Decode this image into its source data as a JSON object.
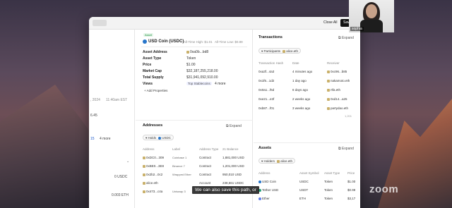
{
  "topbar": {
    "close_all": "Close All",
    "save": "Save"
  },
  "webcam": {
    "name": "sophia"
  },
  "left_pane": {
    "date_fragment": ", 2024",
    "time_fragment": "11:40am EST",
    "number_fragment": "6.45",
    "link_fragment": "15",
    "more": "4 more",
    "usdc_fragment": "0 USDC",
    "eth_fragment": "0.003 ETH"
  },
  "entity": {
    "badge": "Asset",
    "name": "USD Coin (USDC)",
    "ath": "All-Time High: $1.01",
    "atl": "All-Time Low: $0.89",
    "fields": [
      {
        "label": "Asset Address",
        "value": "0xa0b...bd8"
      },
      {
        "label": "Asset Type",
        "value": "Token"
      },
      {
        "label": "Price",
        "value": "$1.00"
      },
      {
        "label": "Market Cap",
        "value": "$32,187,255,218.00"
      },
      {
        "label": "Total Supply",
        "value": "$31,941,092,910.00"
      },
      {
        "label": "Views",
        "value": "Top Stablecoins"
      }
    ],
    "views_more": "4 more",
    "add_properties": "+ Add Properties"
  },
  "addresses": {
    "title": "Addresses",
    "expand": "Expand",
    "filter_key": "Holds",
    "filter_value": "USDC",
    "columns": [
      "Address",
      "Label",
      "Address Type",
      "21 Balance"
    ],
    "rows": [
      {
        "address": "0xDC0...309",
        "label": "Coinbase 1",
        "type": "Contract",
        "balance": "1,881,000 USD"
      },
      {
        "address": "0xBE0...3E8",
        "label": "Binance 7",
        "type": "Contract",
        "balance": "1,201,000 USD"
      },
      {
        "address": "0x2b2...0c2",
        "label": "Wrapped Ether",
        "type": "Contract",
        "balance": "950,010 USD"
      },
      {
        "address": "alice.eth",
        "label": "",
        "type": "Account",
        "balance": "238,661 USDC"
      },
      {
        "address": "0x473...c4a",
        "label": "Uniswap 3",
        "type": "Account",
        "balance": "450,673 USDC"
      }
    ]
  },
  "transactions": {
    "title": "Transactions",
    "expand": "Expand",
    "filter_key": "Participants",
    "filter_value": "alice.eth",
    "columns": [
      "Transaction Hash",
      "Date",
      "Receiver"
    ],
    "rows": [
      {
        "hash": "0xa3f...4a3",
        "date": "4 minutes ago",
        "receiver": "0xc96...b85"
      },
      {
        "hash": "0x1f6...1d2",
        "date": "1 day ago",
        "receiver": "nakamoto.eth"
      },
      {
        "hash": "0x0a1...f6d",
        "date": "6 days ago",
        "receiver": "rtfa.eth"
      },
      {
        "hash": "0xe21...e3f",
        "date": "2 weeks ago",
        "receiver": "0xd14...a25"
      },
      {
        "hash": "0xb87...f01",
        "date": "3 weeks ago",
        "receiver": "partydao.eth"
      }
    ],
    "count": "1,201"
  },
  "assets": {
    "title": "Assets",
    "expand": "Expand",
    "filter_key": "Holders",
    "filter_value": "alice.eth",
    "columns": [
      "Address",
      "Asset Symbol",
      "Asset Type",
      "Price"
    ],
    "rows": [
      {
        "name": "USD Coin",
        "symbol": "USDC",
        "type": "Token",
        "price": "$1.00"
      },
      {
        "name": "Tether USD",
        "symbol": "USDT",
        "type": "Token",
        "price": "$0.99"
      },
      {
        "name": "Ether",
        "symbol": "ETH",
        "type": "Token",
        "price": "$3,17"
      }
    ]
  },
  "caption": "We can also save this path, or",
  "zoom_logo": "zoom"
}
